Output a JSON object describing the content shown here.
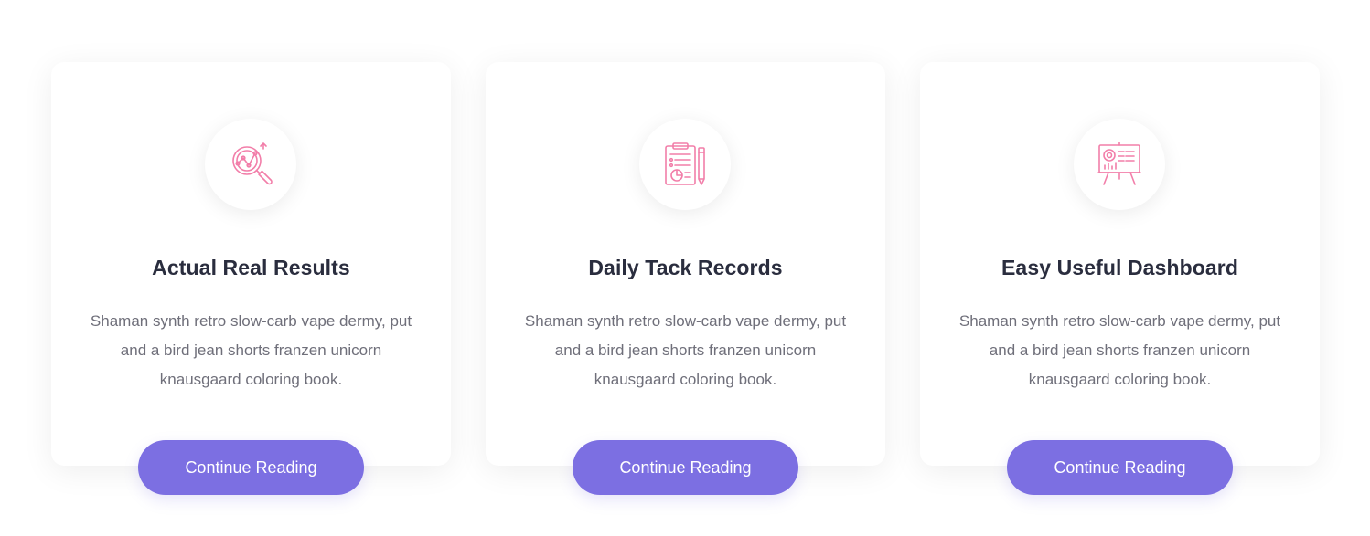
{
  "colors": {
    "accent": "#7c6fe2",
    "icon": "#f27ea9",
    "title": "#2a2d3e",
    "text": "#6f6f7a"
  },
  "cards": [
    {
      "icon": "analytics-search-icon",
      "title": "Actual Real Results",
      "description": "Shaman synth retro slow-carb vape dermy, put and a bird jean shorts franzen unicorn knausgaard coloring book.",
      "button_label": "Continue Reading"
    },
    {
      "icon": "clipboard-report-icon",
      "title": "Daily Tack Records",
      "description": "Shaman synth retro slow-carb vape dermy, put and a bird jean shorts franzen unicorn knausgaard coloring book.",
      "button_label": "Continue Reading"
    },
    {
      "icon": "dashboard-board-icon",
      "title": "Easy Useful Dashboard",
      "description": "Shaman synth retro slow-carb vape dermy, put and a bird jean shorts franzen unicorn knausgaard coloring book.",
      "button_label": "Continue Reading"
    }
  ]
}
